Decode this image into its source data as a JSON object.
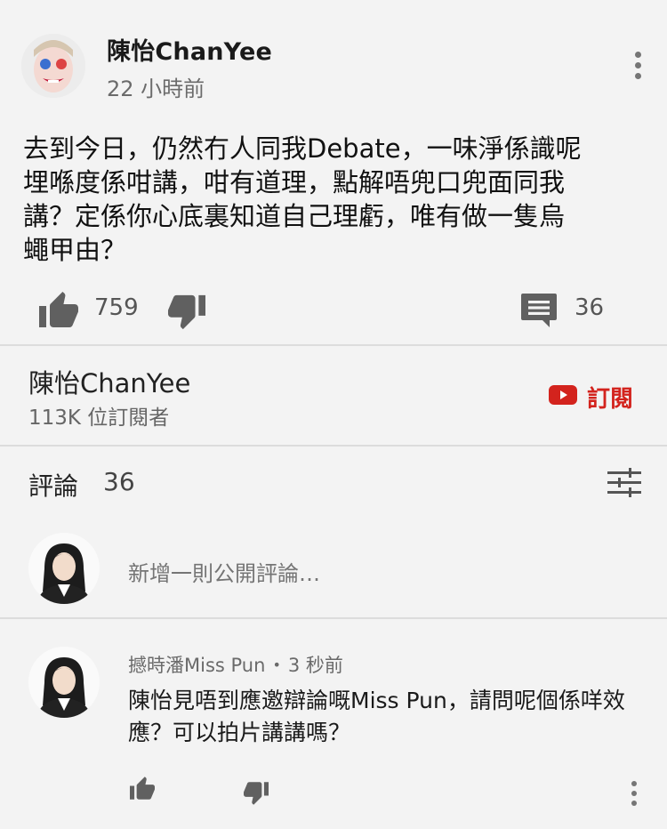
{
  "post": {
    "author": "陳怡ChanYee",
    "time": "22 小時前",
    "body": "去到今日，仍然冇人同我Debate，一味淨係識呢\n埋喺度係咁講，咁有道理，點解唔兜口兜面同我\n講？定係你心底裏知道自己理虧，唯有做一隻烏\n蠅甲由？",
    "likes": "759",
    "replies": "36",
    "icons": {
      "menu": "more-vert-icon",
      "like": "thumbs-up-icon",
      "dislike": "thumbs-down-icon",
      "reply": "comment-icon"
    }
  },
  "channel": {
    "name": "陳怡ChanYee",
    "subscribers": "113K 位訂閱者",
    "subscribe_label": "訂閱",
    "brand_color": "#d3231d"
  },
  "comments": {
    "label": "評論",
    "count": "36",
    "sort_icon": "sort-sliders-icon",
    "add_placeholder": "新增一則公開評論…"
  },
  "reply": {
    "author": "撼時潘Miss Pun",
    "separator": "•",
    "time": "3 秒前",
    "text": "陳怡見唔到應邀辯論嘅Miss Pun，請問呢個係咩效應？可以拍片講講嗎？"
  }
}
